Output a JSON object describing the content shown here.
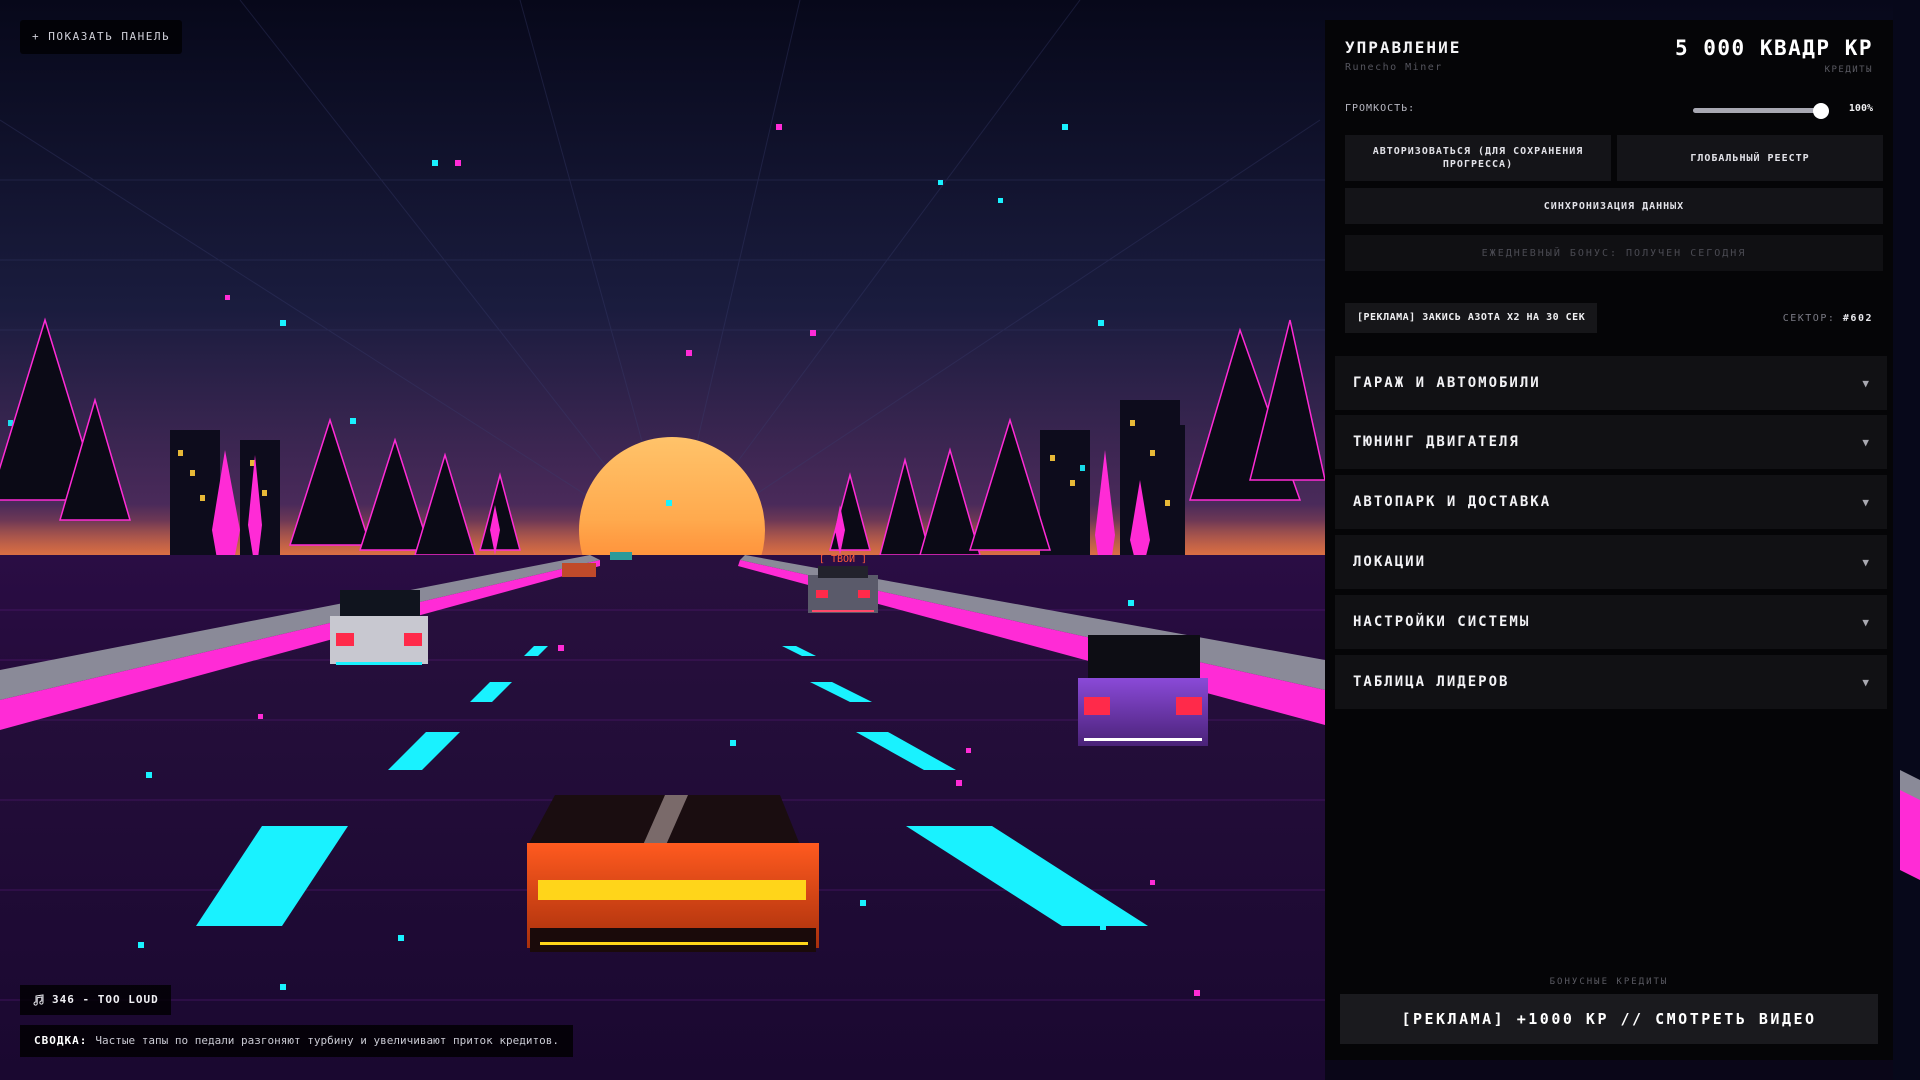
{
  "hud": {
    "show_panel_label": "+ ПОКАЗАТЬ ПАНЕЛЬ",
    "track_label": "346 - TOO LOUD",
    "summary_title": "СВОДКА:",
    "summary_text": "Частые тапы по педали разгоняют турбину и увеличивают приток кредитов."
  },
  "scene": {
    "rival_tag": "[ ТВОЙ ]"
  },
  "panel": {
    "title": "УПРАВЛЕНИЕ",
    "subtitle": "Runecho Miner",
    "credits_value": "5 000 КВАДР КР",
    "credits_label": "КРЕДИТЫ",
    "volume_label": "ГРОМКОСТЬ:",
    "volume_value": "100%",
    "volume_level": 1.0,
    "buttons": {
      "auth": "АВТОРИЗОВАТЬСЯ (ДЛЯ СОХРАНЕНИЯ ПРОГРЕССА)",
      "registry": "ГЛОБАЛЬНЫЙ РЕЕСТР",
      "sync": "СИНХРОНИЗАЦИЯ ДАННЫХ",
      "daily_bonus": "ЕЖЕДНЕВНЫЙ БОНУС: ПОЛУЧЕН СЕГОДНЯ"
    },
    "nitro_ad": "[РЕКЛАМА] ЗАКИСЬ АЗОТА X2 НА 30 СЕК",
    "sector_label": "СЕКТОР:",
    "sector_value": "#602",
    "sections": [
      {
        "label": "ГАРАЖ И АВТОМОБИЛИ"
      },
      {
        "label": "ТЮНИНГ ДВИГАТЕЛЯ"
      },
      {
        "label": "АВТОПАРК И ДОСТАВКА"
      },
      {
        "label": "ЛОКАЦИИ"
      },
      {
        "label": "НАСТРОЙКИ СИСТЕМЫ"
      },
      {
        "label": "ТАБЛИЦА ЛИДЕРОВ"
      }
    ],
    "arrow_glyph": "▼",
    "bonus_label": "БОНУСНЫЕ КРЕДИТЫ",
    "big_ad": "[РЕКЛАМА] +1000 КР // СМОТРЕТЬ ВИДЕО"
  },
  "colors": {
    "sky_top": "#07081a",
    "sky_horizon": "#4a2a5a",
    "sun": "#ffb347",
    "neon_pink": "#ff2bd6",
    "neon_cyan": "#19f2ff",
    "road": "#1a0a2e",
    "player_car": "#ff5a1f"
  }
}
